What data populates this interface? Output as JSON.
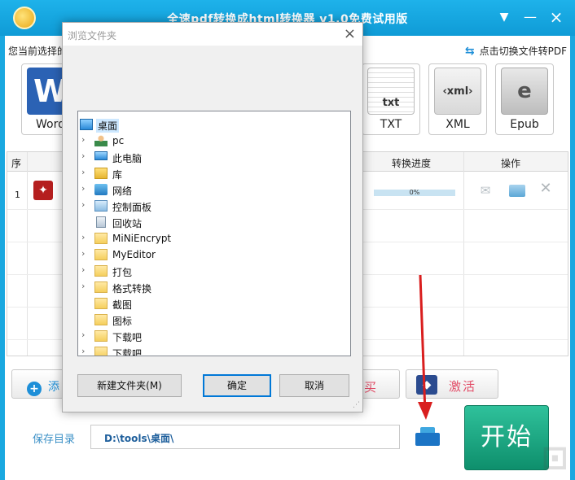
{
  "window": {
    "title": "全速pdf转换成html转换器 v1.0免费试用版",
    "menu_icon": "dropdown-icon",
    "min_icon": "minimize-icon",
    "close_icon": "close-icon"
  },
  "toolbar": {
    "current_label": "您当前选择的",
    "switch_label": "点击切换文件转PDF",
    "formats": [
      {
        "label": "Word",
        "icon_text": "W"
      },
      {
        "label": "TXT",
        "icon_text": "txt"
      },
      {
        "label": "XML",
        "icon_text": "‹xml›"
      },
      {
        "label": "Epub",
        "icon_text": "e"
      }
    ]
  },
  "table": {
    "headers": {
      "seq": "序",
      "progress": "转换进度",
      "ops": "操作"
    },
    "rows": [
      {
        "seq": "1",
        "progress_text": "0%",
        "progress": 0
      }
    ]
  },
  "buttons": {
    "add": "添",
    "buy": "买",
    "activate": "激活",
    "start": "开始"
  },
  "save": {
    "label": "保存目录",
    "path": "D:\\tools\\桌面\\"
  },
  "dialog": {
    "title": "浏览文件夹",
    "tree": [
      {
        "label": "桌面",
        "icon": "desktop-icon",
        "expandable": false,
        "root": true
      },
      {
        "label": "pc",
        "icon": "user-icon",
        "expandable": true
      },
      {
        "label": "此电脑",
        "icon": "computer-icon",
        "expandable": true
      },
      {
        "label": "库",
        "icon": "library-icon",
        "expandable": true
      },
      {
        "label": "网络",
        "icon": "network-icon",
        "expandable": true
      },
      {
        "label": "控制面板",
        "icon": "control-panel-icon",
        "expandable": true
      },
      {
        "label": "回收站",
        "icon": "recycle-bin-icon",
        "expandable": false
      },
      {
        "label": "MiNiEncrypt",
        "icon": "folder-icon",
        "expandable": true
      },
      {
        "label": "MyEditor",
        "icon": "folder-icon",
        "expandable": true
      },
      {
        "label": "打包",
        "icon": "folder-icon",
        "expandable": true
      },
      {
        "label": "格式转换",
        "icon": "folder-icon",
        "expandable": true
      },
      {
        "label": "截图",
        "icon": "folder-icon",
        "expandable": false
      },
      {
        "label": "图标",
        "icon": "folder-icon",
        "expandable": false
      },
      {
        "label": "下载吧",
        "icon": "folder-icon",
        "expandable": true
      },
      {
        "label": "下载吧..",
        "icon": "folder-icon",
        "expandable": true
      }
    ],
    "new_folder": "新建文件夹(M)",
    "ok": "确定",
    "cancel": "取消"
  },
  "colors": {
    "titlebar": "#1aa8e0",
    "start": "#12a07a",
    "accent_red": "#e24b66"
  }
}
